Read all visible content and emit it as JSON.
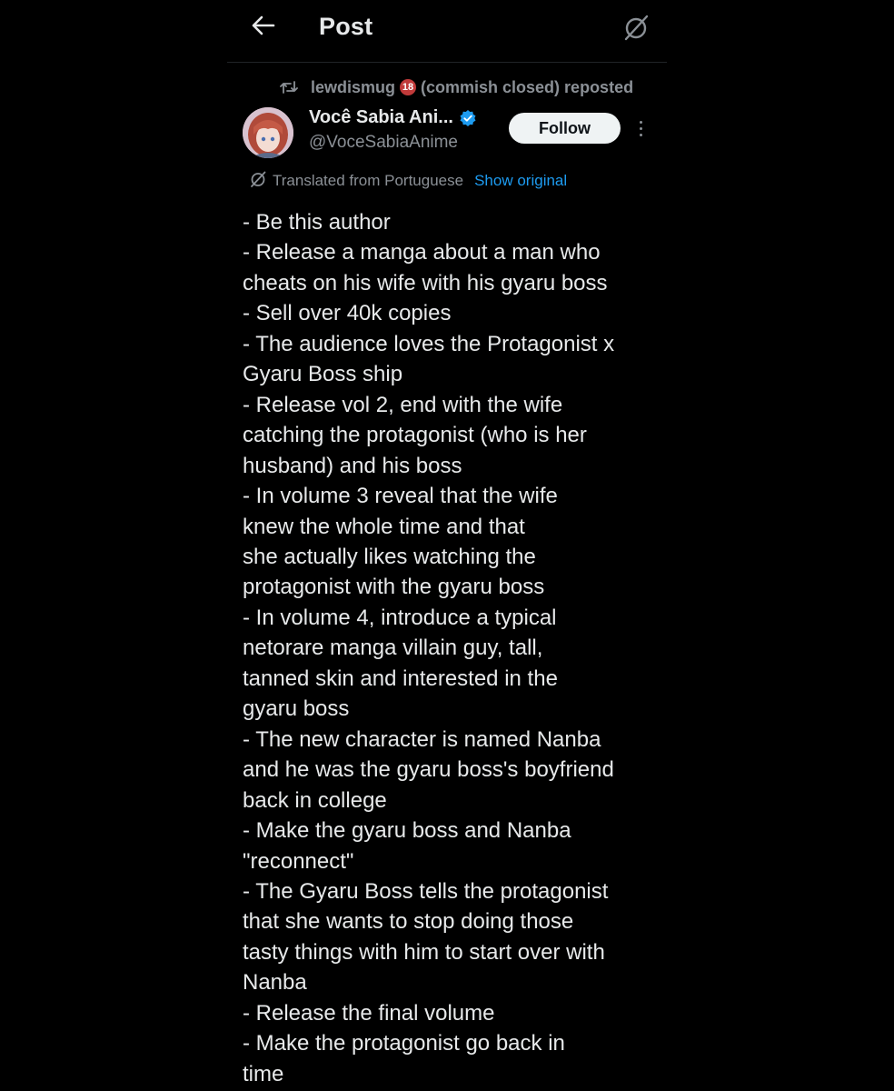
{
  "header": {
    "title": "Post",
    "back_icon": "arrow-left-icon",
    "translate_icon": "translate-slash-icon"
  },
  "repost": {
    "user": "lewdismug",
    "badge": "18",
    "suffix": "(commish closed) reposted",
    "icon": "repost-icon"
  },
  "author": {
    "name": "Você Sabia Ani...",
    "handle": "@VoceSabiaAnime",
    "verified_icon": "verified-badge-icon",
    "follow_label": "Follow",
    "more_icon": "more-vertical-icon"
  },
  "translation": {
    "label": "Translated from Portuguese",
    "show_original": "Show original",
    "icon": "translate-icon"
  },
  "post": {
    "lines": [
      "- Be this author",
      "- Release a manga about a man who",
      "cheats on his wife with his gyaru boss",
      "- Sell over 40k copies",
      "- The audience loves the Protagonist x",
      "Gyaru Boss ship",
      "- Release vol 2, end with the wife",
      "catching the protagonist (who is her",
      "husband) and his boss",
      "- In volume 3 reveal that the wife",
      "knew the whole time and that",
      "she actually likes watching the",
      "protagonist with the gyaru boss",
      "- In volume 4, introduce a typical",
      "netorare manga villain guy, tall,",
      "tanned skin and interested in the",
      "gyaru boss",
      "- The new character is named Nanba",
      "and he was the gyaru boss's boyfriend",
      "back in college",
      "- Make the gyaru boss and Nanba",
      "\"reconnect\"",
      "- The Gyaru Boss tells the protagonist",
      "that she wants to stop doing those",
      "tasty things with him to start over with",
      "Nanba",
      "- Release the final volume",
      "- Make the protagonist go back in",
      "time"
    ]
  },
  "colors": {
    "background": "#000000",
    "text": "#e7e9ea",
    "muted": "#8b9096",
    "link": "#1d9bf0",
    "verified": "#1d9bf0",
    "follow_bg": "#eff3f4"
  }
}
